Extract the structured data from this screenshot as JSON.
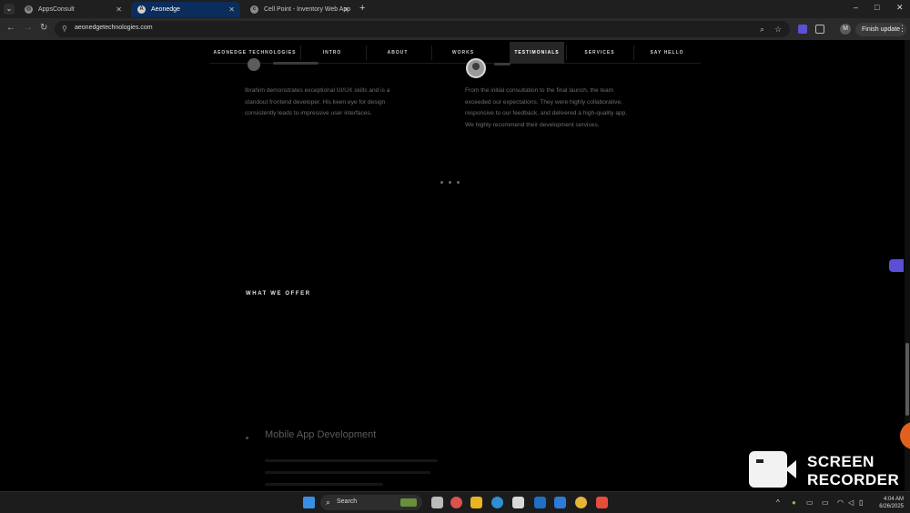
{
  "browser": {
    "tabs": [
      {
        "title": "AppsConsult",
        "active": false
      },
      {
        "title": "Aeonedge",
        "active": true
      },
      {
        "title": "Cell Point - Inventory Web App",
        "active": false
      }
    ],
    "new_tab_glyph": "+",
    "window_controls": {
      "minimize": "–",
      "maximize": "□",
      "close": "✕"
    },
    "url": "aeonedgetechnologies.com",
    "profile_initial": "M",
    "finish_update_label": "Finish update",
    "menu_glyph": "⋮",
    "accent_color": "#0a2d5c"
  },
  "site": {
    "nav": [
      {
        "label": "AEONEDGE TECHNOLOGIES",
        "active": false
      },
      {
        "label": "INTRO",
        "active": false
      },
      {
        "label": "ABOUT",
        "active": false
      },
      {
        "label": "WORKS",
        "active": false
      },
      {
        "label": "TESTIMONIALS",
        "active": true
      },
      {
        "label": "SERVICES",
        "active": false
      },
      {
        "label": "SAY HELLO",
        "active": false
      }
    ],
    "testimonials": [
      {
        "lines": [
          "Ibrahim demonstrates exceptional UI/UX skills and is a",
          "standout frontend developer. His keen eye for design",
          "consistently leads to impressive user interfaces."
        ]
      },
      {
        "lines": [
          "From the initial consultation to the final launch, the team",
          "exceeded our expectations. They were highly collaborative,",
          "responsive to our feedback, and delivered a high-quality app.",
          "We highly recommend their development services."
        ]
      }
    ],
    "what_we_offer": {
      "title": "WHAT WE OFFER",
      "first_service": "Mobile App Development"
    }
  },
  "watermark": {
    "line1": "SCREEN",
    "line2": "RECORDER"
  },
  "taskbar": {
    "search_label": "Search",
    "time": "4:04 AM",
    "date": "6/26/2025"
  }
}
